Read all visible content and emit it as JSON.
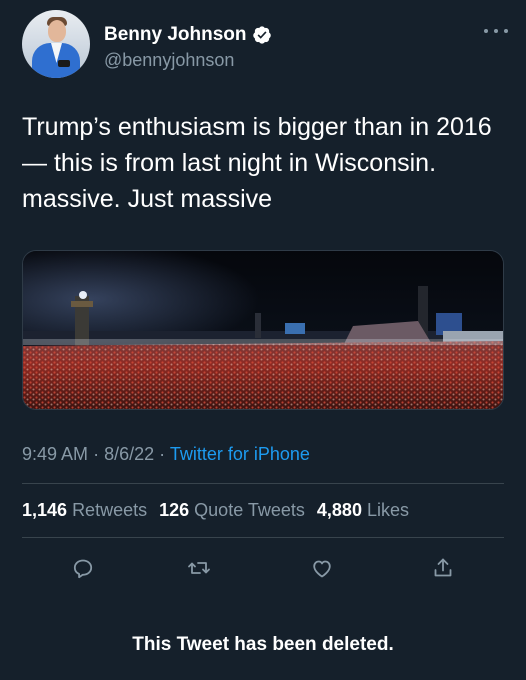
{
  "author": {
    "name": "Benny Johnson",
    "handle": "@bennyjohnson",
    "verified": true,
    "verified_color": "#1d9bf0",
    "avatar_icon": "avatar-photo"
  },
  "tweet": {
    "text": "Trump’s enthusiasm is bigger than in 2016 — this is from last night in Wisconsin. massive. Just massive",
    "media": "photo-of-night-rally-crowd"
  },
  "meta": {
    "time": "9:49 AM",
    "separator": "·",
    "date": "8/6/22",
    "source": "Twitter for iPhone"
  },
  "stats": {
    "retweets_count": "1,146",
    "retweets_label": "Retweets",
    "quotes_count": "126",
    "quotes_label": "Quote Tweets",
    "likes_count": "4,880",
    "likes_label": "Likes"
  },
  "actions": [
    "reply-icon",
    "retweet-icon",
    "like-icon",
    "share-icon"
  ],
  "notice": "This Tweet has been deleted.",
  "colors": {
    "background": "#15202b",
    "secondary_text": "#8899a6",
    "link": "#1d9bf0",
    "divider": "#38444d"
  }
}
